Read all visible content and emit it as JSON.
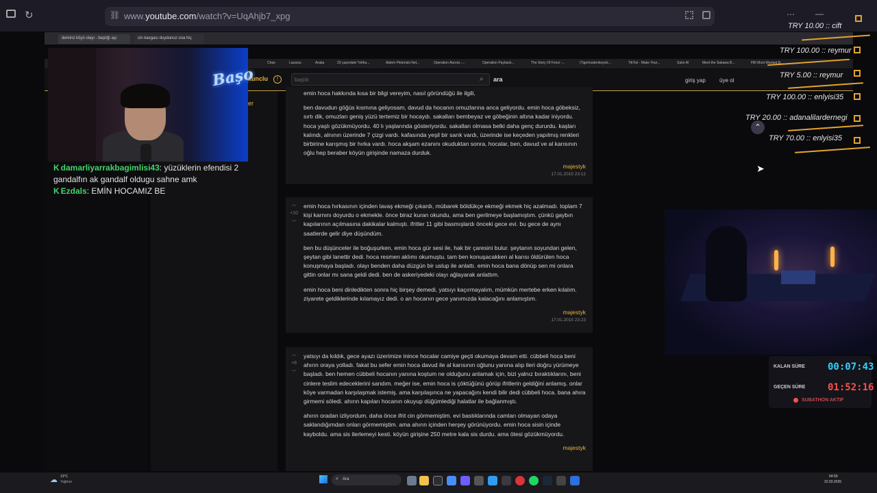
{
  "browser": {
    "url_prefix": "www.",
    "url_domain": "youtube.com",
    "url_path": "/watch?v=UqAhjb7_xpg"
  },
  "inner_tabs": [
    {
      "label": "demirci köyü olayı - başlığı açı"
    },
    {
      "label": "cin kavgası duydunuz ona hiç"
    }
  ],
  "bookmarks": [
    "Chao",
    "Lazarus",
    "Araba",
    "23 yaşındaki \"intiha...",
    "Aidem Pletonski Net...",
    "Operation Aurora -...",
    "Operation Payback...",
    "The Story Of Fonzi -...",
    "(Tigerloodenkeyolc...",
    "TikTok - Make Your...",
    "Satın Al",
    "Meet the Sakawa B...",
    "FBI Most Wanted B..."
  ],
  "site": {
    "logo": "kunclu",
    "search_placeholder": "başlık",
    "search_button": "ara",
    "login": "giriş yap",
    "register": "üye ol",
    "side_fragment": "er"
  },
  "entries": [
    {
      "paragraphs": [
        "emin hoca hakkında kısa bir bilgi vereyim, nasıl göründüğü ile ilgili,",
        "ben davudun göğüs kısmına geliyosam, davud da hocanın omuzlarına anca geliyordu. emin hoca göbeksiz, sırtı dik, omuzları geniş yüzü tertemiz bir hocaydı. sakalları bembeyaz ve göbeğinin altına kadar iniyordu. hoca yaşlı gözükmüyordu. 40 lı yaşlarında gösteriyordu. sakalları olmasa belki daha genç dururdu. kaşları kalındı, alnının üzerinde 7 çizgi vardı. kafasında yeşil bir sarık vardı, üzerinde ise keçeden yapılmış renkleri birbirine karışmış bir hırka vardı. hoca akşam ezanını okuduktan sonra, hocalar, ben, davud ve al karısının oğlu hep beraber köyün girişinde namaza durduk."
      ],
      "author": "majestyk",
      "date": "17.01.2015 23:12"
    },
    {
      "vote": "+10",
      "paragraphs": [
        "emin hoca hırkasının içinden lavaş ekmeği çıkardı, mübarek böldükçe ekmeği ekmek hiç azalmadı. toplam 7 kişi karnını doyurdu o ekmekle. önce biraz kuran okundu, ama ben gerilmeye başlamıştım. çünkü gaybın kapılarının açılmasına dakikalar kalmıştı. ifritler 11 gibi basmışlardı önceki gece evi. bu gece de aynı saatlerde gelir diye düşündüm.",
        "ben bu düşünceler ile boğuşurken, emin hoca gür sesi ile, hak bir çaresini bulur. şeytanın soyundan gelen, şeytan gibi lanettir dedi. hoca resmen aklımı okumuştu. tam ben konuşacakken al karısı öldürülen hoca konuşmaya başladı. olayı benden daha düzgün bir uslup ile anlattı. emin hoca bana dönüp sen mi onlara gittin onlar mı sana geldi dedi. ben de askeriyedeki olayı ağlayarak anlattım.",
        "emin hoca beni dinledikten sonra hiç birşey demedi, yatsıyı kaçırmayalım, mümkün mertebe erken kılalım. ziyarete geldiklerinde kılamayız dedi. o an hocanın gece yanımızda kalacağını anlamıştım."
      ],
      "author": "majestyk",
      "date": "17.01.2015 23:23"
    },
    {
      "vote": "+8",
      "paragraphs": [
        "yatsıyı da kıldık, gece ayazı üzerimize inince hocalar camiye geçti okumaya devam etti. cübbeli hoca beni ahırın oraya yolladı. fakat bu sefer emin hoca davud ile al karısının oğlunu yanına alıp ileri doğru yürümeye başladı. ben hemen cübbeli hocanın yanına koştum ne olduğunu anlamak için, bizi yalnız bıraktıklarını, beni cinlere teslim edeceklerini sandım. meğer ise, emin hoca is çöktüğünü görüp ifritlerin geldiğini anlamış. onlar köye varmadan karşılaşmak istemiş. ama karşılaşınca ne yapacağını kendi bilir dedi cübbeli hoca. bana ahıra girmemi söledi. ahırın kapıları hocanın okuyup düğümlediği halatlar ile bağlanmıştı.",
        "ahırın oradan izliyordum. daha önce ifrit cin görmemiştim. evi bastıklarında camları olmayan odaya saklandığımdan onları görmemiştim. ama ahırın içinden herşey görünüyordu. emin hoca sisin içinde kayboldu. ama sis ilerlemeyi kesti. köyün girişine 250 metre kala sis durdu. ama ötesi gözükmüyordu."
      ],
      "author": "majestyk"
    }
  ],
  "chat": [
    {
      "user": "damarliyarrakbagimlisi43",
      "message": "yüzüklerin efendisi 2 gandalfın ak gandalf oldugu sahne amk"
    },
    {
      "user": "Ezdals",
      "message": "EMİN HOCAMIZ BE"
    }
  ],
  "donations": [
    {
      "text": "TRY 10.00 :: cift"
    },
    {
      "text": "TRY 100.00 :: reymur"
    },
    {
      "text": "TRY 5.00 :: reymur"
    },
    {
      "text": "TRY 100.00 :: enlyisi35"
    },
    {
      "text": "TRY 20.00 :: adanalilardernegi"
    },
    {
      "text": "TRY 70.00 :: enlyisi35"
    }
  ],
  "timer": {
    "remaining_label": "KALAN SÜRE",
    "remaining_value": "00:07:43",
    "elapsed_label": "GEÇEN SÜRE",
    "elapsed_value": "01:52:16",
    "status": "SUBATHON AKTIF",
    "colors": {
      "remaining": "#33d1ff",
      "elapsed": "#ff4f4f",
      "status": "#ff4f4f"
    }
  },
  "overlay_neon": "Başo",
  "taskbar": {
    "weather_temp": "13°C",
    "weather_desc": "Yağmur",
    "search_label": "Ara",
    "time": "04:59",
    "date": "22.03.2026"
  },
  "icons": [
    "sidebar-toggle-icon",
    "reload-icon",
    "site-info-icon",
    "grid-icon",
    "extension-icon",
    "more-icon",
    "minimize-icon",
    "search-icon",
    "up-chevron-icon",
    "windows-icon"
  ]
}
